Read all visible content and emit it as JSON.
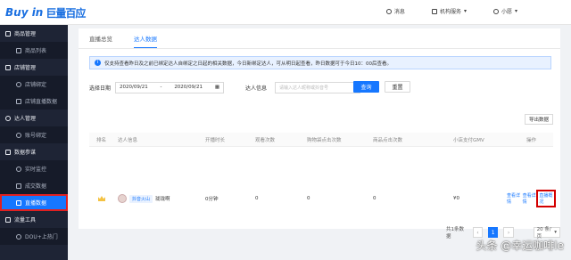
{
  "brand": {
    "logo_en": "Buy in",
    "logo_zh": "巨量百应"
  },
  "header": {
    "messages": "消息",
    "org_service": "机构服务",
    "user": "小愿"
  },
  "sidebar": {
    "groups": [
      {
        "label": "商品管理",
        "items": [
          {
            "label": "商品列表"
          }
        ]
      },
      {
        "label": "店铺管理",
        "items": [
          {
            "label": "店铺绑定"
          },
          {
            "label": "店铺直播数据"
          }
        ]
      },
      {
        "label": "达人管理",
        "items": [
          {
            "label": "账号绑定"
          }
        ]
      },
      {
        "label": "数据参谋",
        "items": [
          {
            "label": "实时监控"
          },
          {
            "label": "成交数据"
          },
          {
            "label": "直播数据"
          }
        ]
      },
      {
        "label": "流量工具",
        "items": [
          {
            "label": "DOU+上热门"
          }
        ]
      }
    ]
  },
  "tabs": [
    {
      "label": "直播总览"
    },
    {
      "label": "达人数据"
    }
  ],
  "notice": {
    "text": "仅支持查看昨日及之前已绑定达人自绑定之日起的相关数据，今日新绑定达人，可从明日起查看，昨日数据可于今日10：00后查看。"
  },
  "filter": {
    "date_label": "选择日期",
    "date_start": "2020/09/21",
    "date_sep": "-",
    "date_end": "2020/09/21",
    "influencer_label": "达人信息",
    "influencer_placeholder": "请输入达人昵称或抖音号",
    "search_button": "查询",
    "reset_button": "重置"
  },
  "export_button": "导出数据",
  "table": {
    "headers": [
      "排名",
      "达人信息",
      "开播时长",
      "观看次数",
      "购物袋点击次数",
      "商品点击次数",
      "小店支付GMV",
      "操作"
    ],
    "rows": [
      {
        "platform": "抖音火山",
        "name": "珑珑啊",
        "duration": "0分钟",
        "views": "0",
        "cart_clicks": "0",
        "product_clicks": "0",
        "gmv": "¥0",
        "action_1": "查看详情",
        "action_2": "查看详情",
        "action_3": "直播概况"
      }
    ]
  },
  "pagination": {
    "total": "共1条数据",
    "current": "1",
    "page_size": "20 条/页"
  },
  "watermark": "头条 @幸运咖啡le"
}
